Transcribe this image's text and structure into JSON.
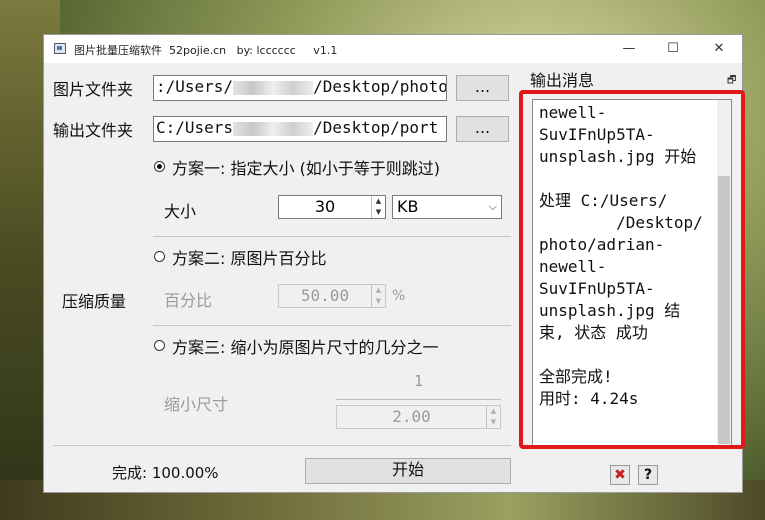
{
  "window": {
    "title": "图片批量压缩软件  52pojie.cn   by: lcccccc     v1.1",
    "minimize": "—",
    "maximize": "☐",
    "close": "✕"
  },
  "input_folder": {
    "label": "图片文件夹",
    "value_prefix": ":/Users/",
    "value_suffix": "/Desktop/photo",
    "browse": "..."
  },
  "output_folder": {
    "label": "输出文件夹",
    "value_prefix": "C:/Users",
    "value_suffix": "/Desktop/port",
    "browse": "..."
  },
  "quality": {
    "label": "压缩质量",
    "plan1": {
      "label": "方案一: 指定大小 (如小于等于则跳过)",
      "selected": true,
      "size_label": "大小",
      "size_value": "30",
      "unit": "KB"
    },
    "plan2": {
      "label": "方案二: 原图片百分比",
      "selected": false,
      "percent_label": "百分比",
      "percent_value": "50.00",
      "percent_sign": "%"
    },
    "plan3": {
      "label": "方案三: 缩小为原图片尺寸的几分之一",
      "selected": false,
      "shrink_label": "缩小尺寸",
      "numerator": "1",
      "denominator": "2.00"
    }
  },
  "progress": {
    "label": "完成: 100.00%",
    "value": 1.0
  },
  "start_button": "开始",
  "output_panel": {
    "title": "输出消息",
    "float_icon": "🗗",
    "text": "newell-\nSuvIFnUp5TA-\nunsplash.jpg 开始\n\n处理 C:/Users/\n        /Desktop/\nphoto/adrian-\nnewell-\nSuvIFnUp5TA-\nunsplash.jpg 结\n束, 状态 成功\n\n全部完成!\n用时: 4.24s",
    "highlight_color": "#e01818"
  },
  "bottom_icons": {
    "clear": "✖",
    "help": "?"
  }
}
